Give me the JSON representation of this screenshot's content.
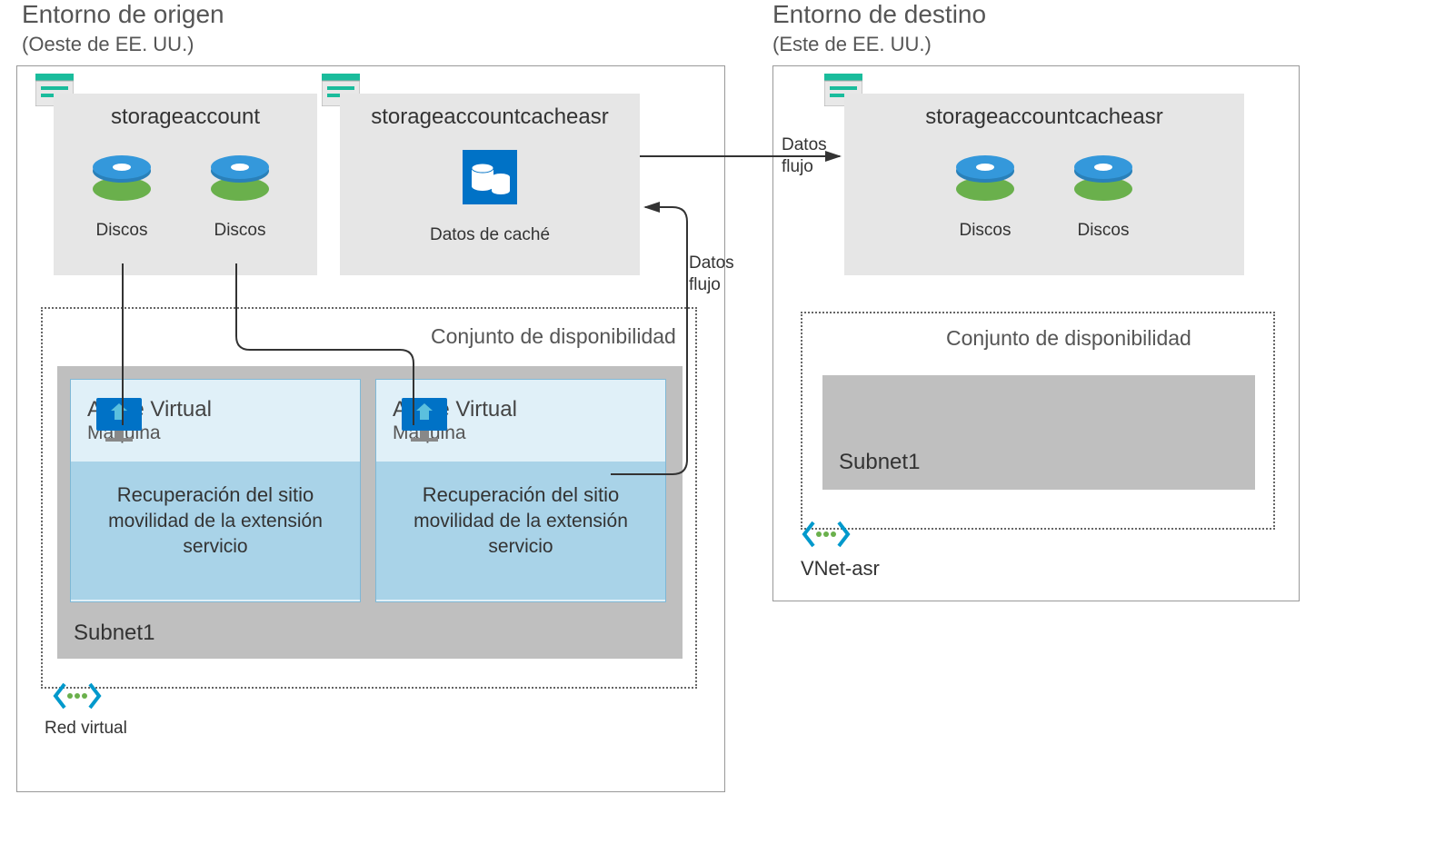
{
  "source": {
    "title": "Entorno de origen",
    "subtitle": "(Oeste de EE. UU.)",
    "storage1": {
      "title": "storageaccount",
      "disk1": "Discos",
      "disk2": "Discos"
    },
    "storage2": {
      "title": "storageaccountcacheasr",
      "cache": "Datos de caché"
    },
    "availability": "Conjunto de disponibilidad",
    "vm1": {
      "title": "Azure Virtual",
      "sub": "Máquina",
      "recov1": "Recuperación del sitio",
      "recov2": "movilidad de la extensión",
      "recov3": "servicio"
    },
    "vm2": {
      "title": "Azure Virtual",
      "sub": "Máquina",
      "recov1": "Recuperación del sitio",
      "recov2": "movilidad de la extensión",
      "recov3": "servicio"
    },
    "subnet": "Subnet1",
    "vnet": "Red virtual"
  },
  "target": {
    "title": "Entorno de destino",
    "subtitle": "(Este de EE. UU.)",
    "storage": {
      "title": "storageaccountcacheasr",
      "disk1": "Discos",
      "disk2": "Discos"
    },
    "availability": "Conjunto de disponibilidad",
    "subnet": "Subnet1",
    "vnet": "VNet-asr"
  },
  "flows": {
    "flow1": "Datos",
    "flow1b": "flujo",
    "flow2": "Datos",
    "flow2b": "flujo"
  }
}
